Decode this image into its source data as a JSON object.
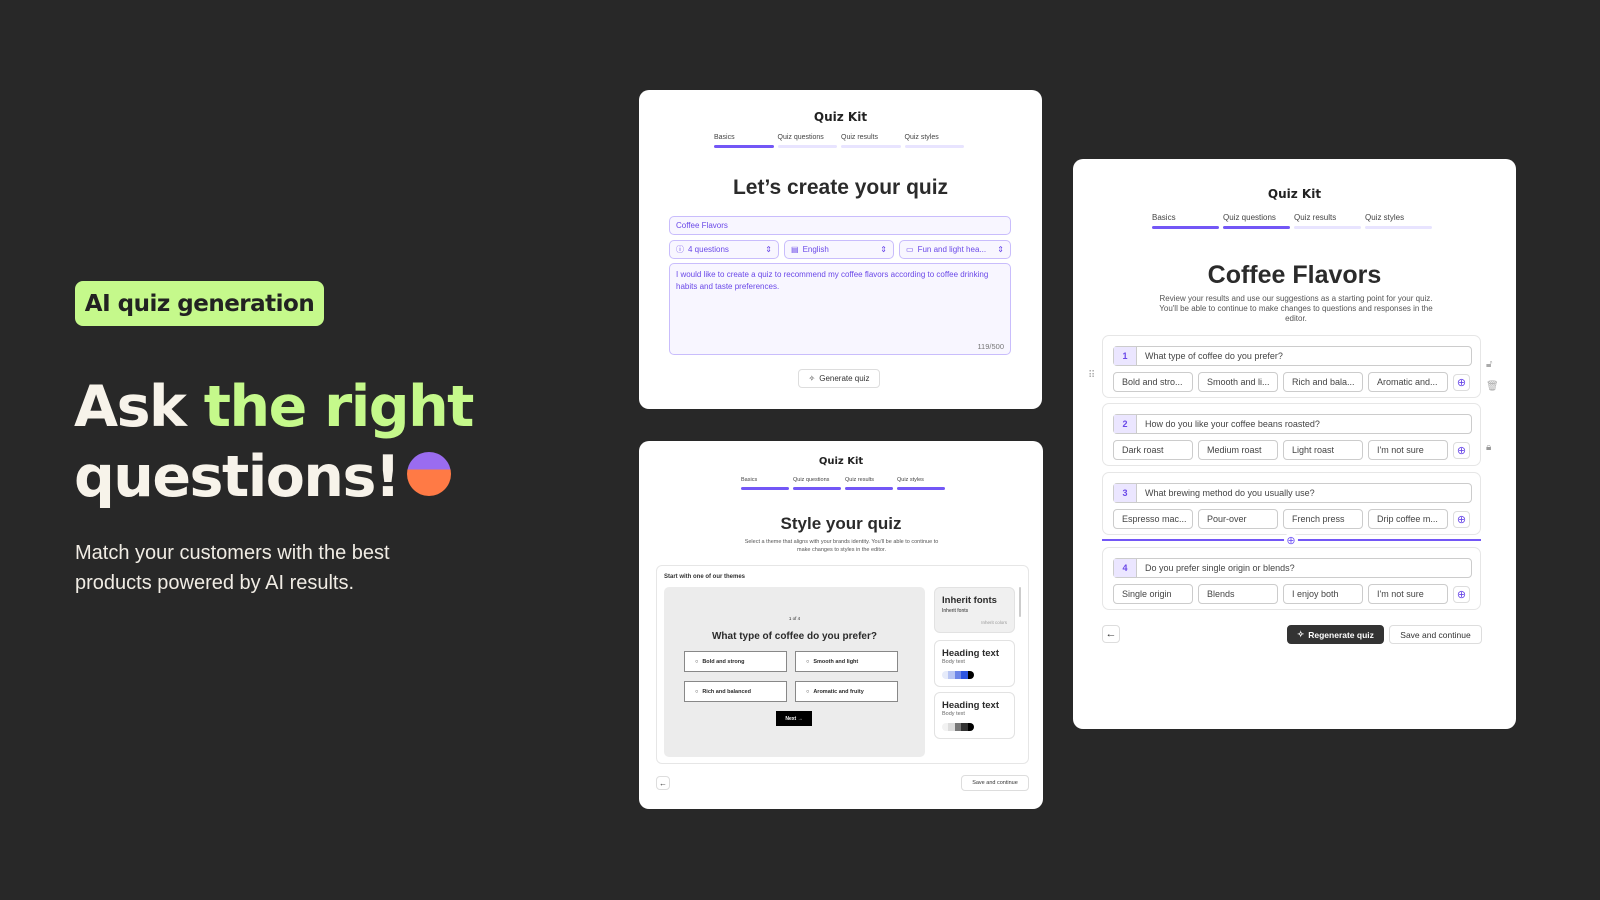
{
  "hero": {
    "badge": "AI quiz generation",
    "headline_a": "Ask ",
    "headline_b": "the right",
    "headline_c": "questions!",
    "subtitle": "Match your customers with the best products powered by AI results.",
    "icon": "crystal-ball-icon"
  },
  "colors": {
    "background": "#282828",
    "accent_green": "#c5f98b",
    "accent_purple": "#7357f6"
  },
  "brand": "Quiz Kit",
  "steps": [
    "Basics",
    "Quiz questions",
    "Quiz results",
    "Quiz styles"
  ],
  "basics": {
    "heading": "Let’s create your quiz",
    "quiz_name": "Coffee Flavors",
    "question_count": "4 questions",
    "language": "English",
    "tone": "Fun and light hea...",
    "prompt": "I would like to create a quiz to recommend my coffee flavors according to coffee drinking habits and taste preferences.",
    "char_count": "119/500",
    "generate_label": "Generate quiz"
  },
  "styles": {
    "heading": "Style your quiz",
    "description": "Select a theme that aligns with your brands identity. You'll be able to continue to make changes to styles in the editor.",
    "themes_label": "Start with one of our themes",
    "preview": {
      "progress": "1 of 4",
      "question": "What type of coffee do you prefer?",
      "options": [
        "Bold and strong",
        "Smooth and light",
        "Rich and balanced",
        "Aromatic and fruity"
      ],
      "next": "Next →"
    },
    "themes": [
      {
        "title": "Inherit fonts",
        "body": "Inherit fonts",
        "extra": "Inherit colors"
      },
      {
        "title": "Heading text",
        "body": "Body text"
      },
      {
        "title": "Heading text",
        "body": "Body text"
      }
    ],
    "save_label": "Save and continue"
  },
  "questions": {
    "heading": "Coffee Flavors",
    "description": "Review your results and use our suggestions as a starting point for your quiz. You'll be able to continue to make changes to questions and responses in the editor.",
    "items": [
      {
        "num": "1",
        "text": "What type of coffee do you prefer?",
        "options": [
          "Bold and stro...",
          "Smooth and li...",
          "Rich and bala...",
          "Aromatic and..."
        ]
      },
      {
        "num": "2",
        "text": "How do you like your coffee beans roasted?",
        "options": [
          "Dark roast",
          "Medium roast",
          "Light roast",
          "I'm not sure"
        ]
      },
      {
        "num": "3",
        "text": "What brewing method do you usually use?",
        "options": [
          "Espresso mac...",
          "Pour-over",
          "French press",
          "Drip coffee m..."
        ]
      },
      {
        "num": "4",
        "text": "Do you prefer single origin or blends?",
        "options": [
          "Single origin",
          "Blends",
          "I enjoy both",
          "I'm not sure"
        ]
      }
    ],
    "regenerate_label": "Regenerate quiz",
    "save_label": "Save and continue"
  }
}
